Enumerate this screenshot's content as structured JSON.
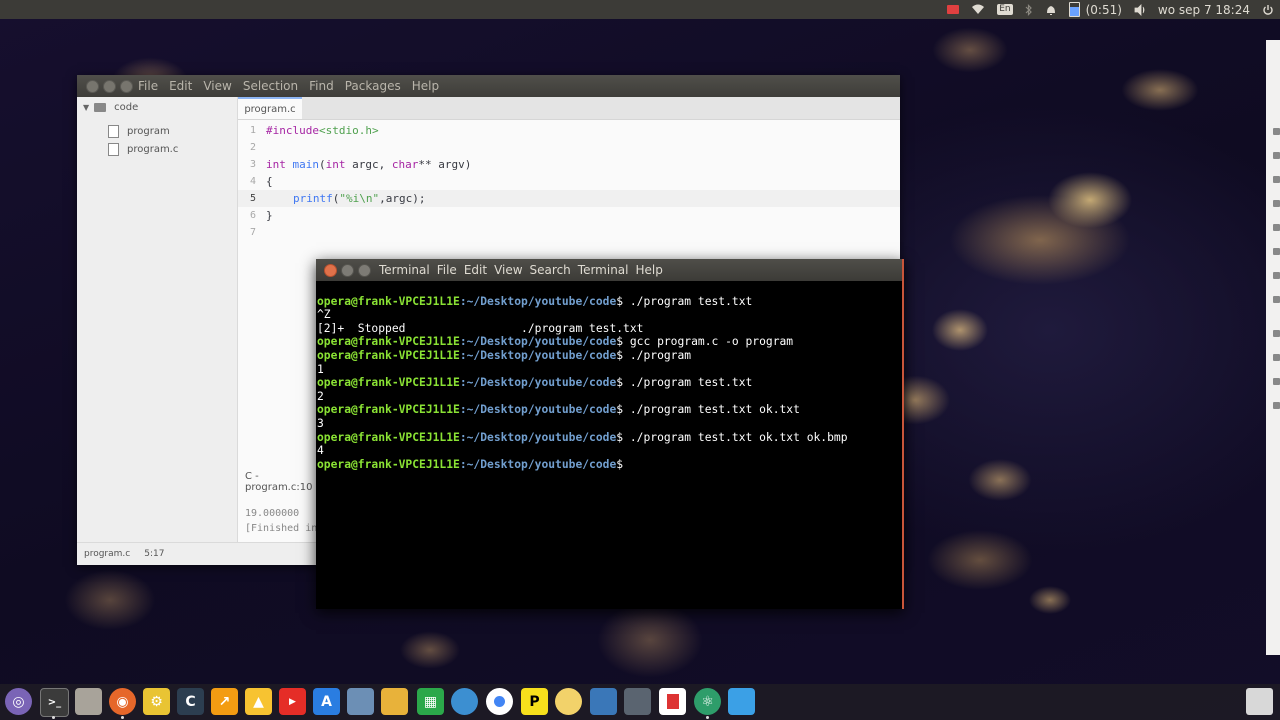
{
  "top_panel": {
    "battery_text": "(0:51)",
    "keyboard_layout": "En",
    "clock": "wo sep  7 18:24",
    "icons": [
      "record-indicator-icon",
      "wifi-icon",
      "keyboard-icon",
      "bluetooth-icon",
      "mail-icon",
      "battery-icon",
      "volume-icon",
      "power-icon"
    ]
  },
  "editor": {
    "menu": [
      "File",
      "Edit",
      "View",
      "Selection",
      "Find",
      "Packages",
      "Help"
    ],
    "tree": {
      "root": "code",
      "files": [
        "program",
        "program.c"
      ]
    },
    "tab_label": "program.c",
    "line_numbers": [
      "1",
      "2",
      "3",
      "4",
      "5",
      "6",
      "7"
    ],
    "code": {
      "l1_directive": "#include",
      "l1_header": " <stdio.h>",
      "l3_int": "int",
      "l3_main": " main",
      "l3_paren": "(",
      "l3_int2": "int",
      "l3_argc": " argc, ",
      "l3_char": "char",
      "l3_rest": "** argv)",
      "l4": "{",
      "l5_printf": "printf",
      "l5_open": "(",
      "l5_fmt": "\"%i\\n\"",
      "l5_rest": ",argc);",
      "l6": "}"
    },
    "console_tab": "C - program.c:10",
    "console_lines": [
      "19.000000",
      "[Finished in"
    ],
    "status_file": "program.c",
    "status_pos": "5:17"
  },
  "terminal": {
    "title": "Terminal",
    "menu": [
      "File",
      "Edit",
      "View",
      "Search",
      "Terminal",
      "Help"
    ],
    "prompt_user": "opera@frank-VPCEJ1L1E",
    "prompt_path": ":~/Desktop/youtube/code",
    "prompt_end": "$ ",
    "lines": {
      "cmd1": "./program test.txt",
      "out1": "^Z",
      "out2": "[2]+  Stopped                 ./program test.txt",
      "cmd2": "gcc program.c -o program",
      "cmd3": "./program",
      "out3": "1",
      "cmd4": "./program test.txt",
      "out4": "2",
      "cmd5": "./program test.txt ok.txt",
      "out5": "3",
      "cmd6": "./program test.txt ok.txt ok.bmp",
      "out6": "4"
    }
  },
  "dock": {
    "items": [
      "ubuntu-home-icon",
      "terminal-icon",
      "files-icon",
      "firefox-icon",
      "settings-icon",
      "ccleaner-icon",
      "system-monitor-icon",
      "google-drive-icon",
      "youtube-icon",
      "text-editor-icon",
      "network-icon",
      "folder-icon",
      "libreoffice-calc-icon",
      "remmina-icon",
      "chrome-icon",
      "plex-icon",
      "cheese-icon",
      "virtualbox-icon",
      "storage-icon",
      "pdf-icon",
      "atom-icon",
      "window-icon",
      "trash-icon"
    ]
  }
}
